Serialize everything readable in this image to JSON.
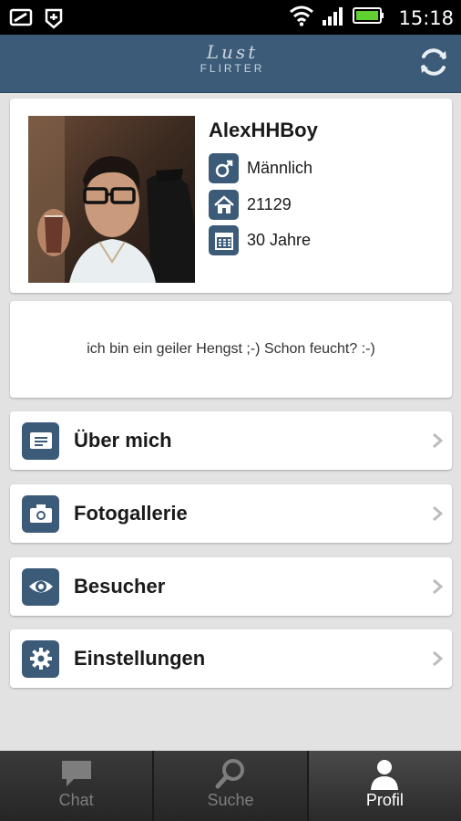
{
  "status_bar": {
    "time": "15:18"
  },
  "app_bar": {
    "logo_script": "Lust",
    "logo_word": "FLIRTER"
  },
  "profile": {
    "username": "AlexHHBoy",
    "gender": "Männlich",
    "zip": "21129",
    "age": "30 Jahre",
    "bio": "ich bin ein geiler Hengst ;-) Schon feucht? :-)"
  },
  "menu": {
    "about": "Über mich",
    "gallery": "Fotogallerie",
    "visitors": "Besucher",
    "settings": "Einstellungen"
  },
  "tabs": {
    "chat": "Chat",
    "search": "Suche",
    "profile": "Profil"
  },
  "colors": {
    "accent": "#3c5b78",
    "tab_active_text": "#ffffff",
    "tab_inactive_text": "#7d7d7d"
  }
}
